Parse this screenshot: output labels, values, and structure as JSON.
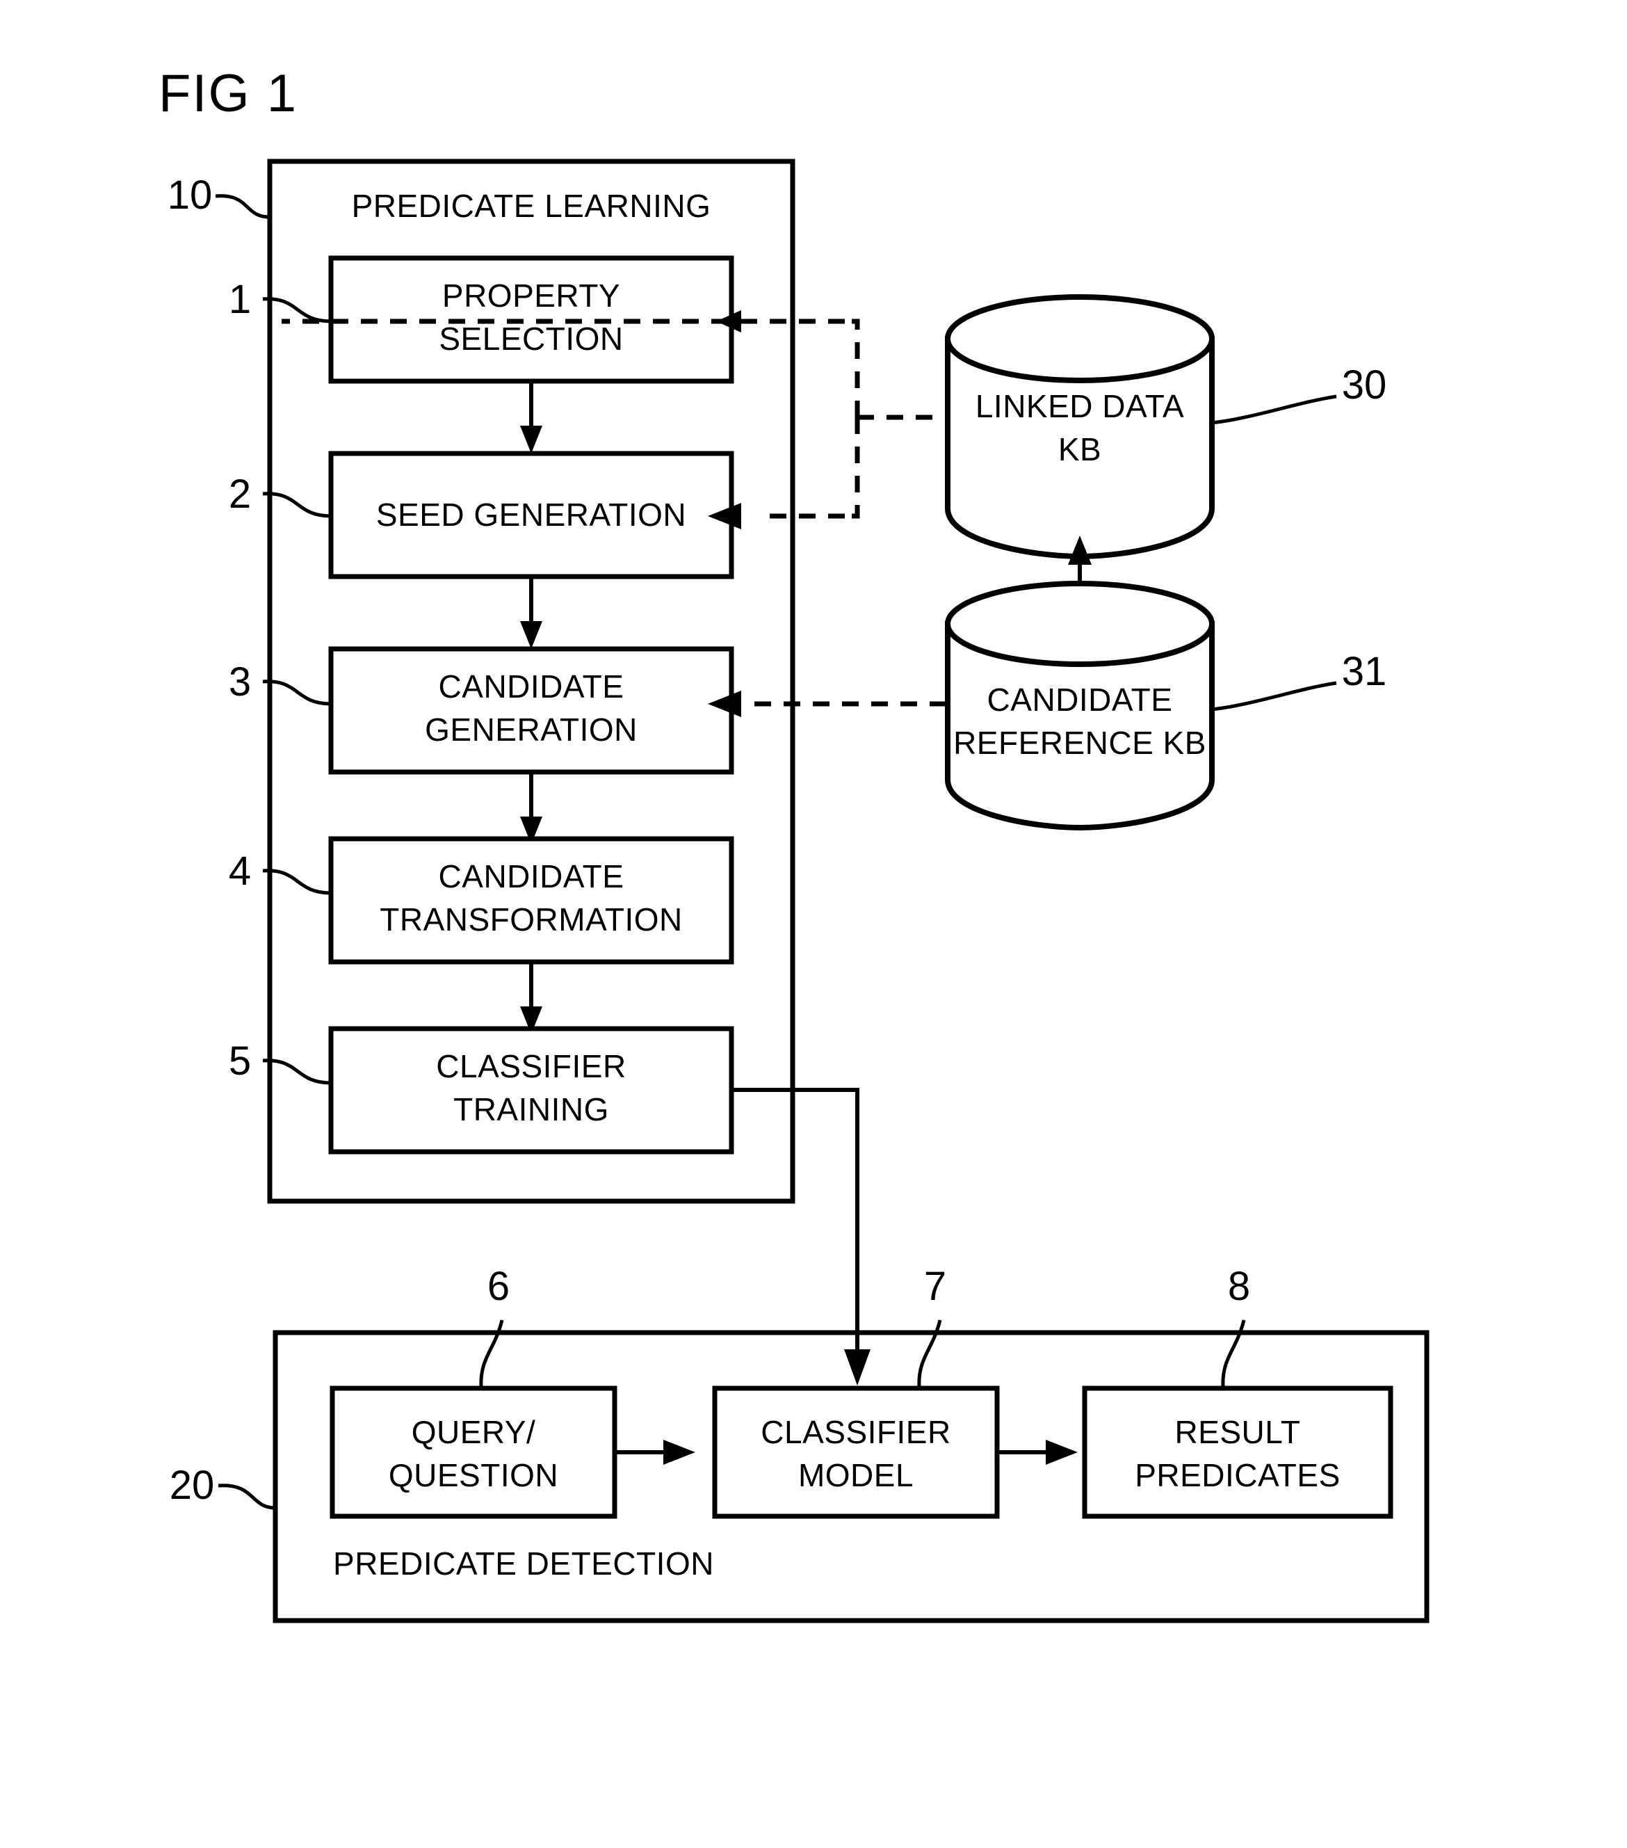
{
  "figure": {
    "label": "FIG 1"
  },
  "containers": [
    {
      "id": "predicate-learning",
      "ref": "10",
      "title": "PREDICATE LEARNING"
    },
    {
      "id": "predicate-detection",
      "ref": "20",
      "title": "PREDICATE DETECTION"
    }
  ],
  "learning_steps": [
    {
      "ref": "1",
      "line1": "PROPERTY",
      "line2": "SELECTION"
    },
    {
      "ref": "2",
      "line1": "SEED GENERATION",
      "line2": ""
    },
    {
      "ref": "3",
      "line1": "CANDIDATE",
      "line2": "GENERATION"
    },
    {
      "ref": "4",
      "line1": "CANDIDATE",
      "line2": "TRANSFORMATION"
    },
    {
      "ref": "5",
      "line1": "CLASSIFIER",
      "line2": "TRAINING"
    }
  ],
  "knowledge_bases": [
    {
      "ref": "30",
      "line1": "LINKED DATA",
      "line2": "KB"
    },
    {
      "ref": "31",
      "line1": "CANDIDATE",
      "line2": "REFERENCE KB"
    }
  ],
  "detection_steps": [
    {
      "ref": "6",
      "line1": "QUERY/",
      "line2": "QUESTION"
    },
    {
      "ref": "7",
      "line1": "CLASSIFIER",
      "line2": "MODEL"
    },
    {
      "ref": "8",
      "line1": "RESULT",
      "line2": "PREDICATES"
    }
  ],
  "colors": {
    "ink": "#000000",
    "paper": "#ffffff"
  }
}
